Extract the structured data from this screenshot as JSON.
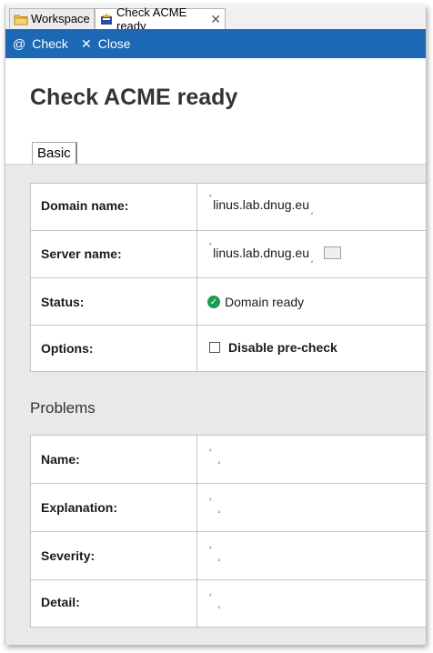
{
  "tabs": [
    {
      "label": "Workspace",
      "icon": "folder-icon",
      "active": false
    },
    {
      "label": "Check ACME ready",
      "icon": "acme-form-icon",
      "active": true,
      "close": "✕"
    }
  ],
  "actionbar": {
    "color": "#1c68b4",
    "check": {
      "symbol": "@",
      "label": "Check"
    },
    "close": {
      "symbol": "✕",
      "label": "Close"
    }
  },
  "page": {
    "title": "Check ACME ready"
  },
  "form_tab": {
    "label": "Basic"
  },
  "basic": {
    "domain": {
      "label": "Domain name:",
      "value": "linus.lab.dnug.eu"
    },
    "server": {
      "label": "Server name:",
      "value": "linus.lab.dnug.eu"
    },
    "status": {
      "label": "Status:",
      "value": "Domain ready",
      "icon": "check-circle-icon",
      "color": "#1c9e50"
    },
    "options": {
      "label": "Options:",
      "value": "Disable pre-check",
      "checked": false
    }
  },
  "problems": {
    "title": "Problems",
    "name": {
      "label": "Name:"
    },
    "explanation": {
      "label": "Explanation:"
    },
    "severity": {
      "label": "Severity:"
    },
    "detail": {
      "label": "Detail:"
    }
  },
  "field_bracket_open": "⸢",
  "field_bracket_close": "⸥"
}
